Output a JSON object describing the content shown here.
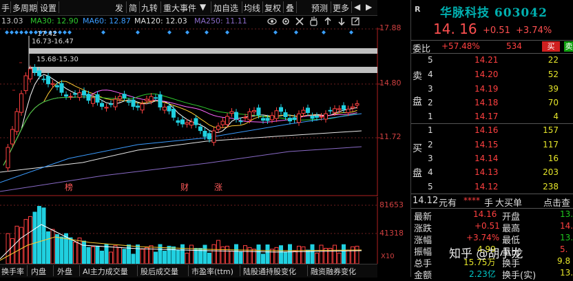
{
  "toolbar": {
    "left_items": [
      "手",
      "多周期",
      "设置"
    ],
    "right_items": [
      "发",
      "简",
      "九转",
      "重大事件",
      "加自选",
      "均线",
      "复权",
      "叠",
      "预测",
      "更多"
    ],
    "dropdown_arrow": "▼",
    "prev_arrow": "◀",
    "next_arrow": "▶"
  },
  "ma_legend": [
    {
      "label": "13.03",
      "color": "#c8c8c8"
    },
    {
      "label": "MA30: 12.90",
      "color": "#2ec82e"
    },
    {
      "label": "MA60: 12.87",
      "color": "#3b9cff"
    },
    {
      "label": "MA120: 12.03",
      "color": "#e0e0e0"
    },
    {
      "label": "MA250: 11.11",
      "color": "#8a6bc8"
    }
  ],
  "ma_icons": [
    "eye-icon",
    "settings-icon",
    "close-icon",
    "hand-icon",
    "arrow-up-icon",
    "arrow-down-icon",
    "share-icon"
  ],
  "price_axis": [
    "17.88",
    "14.80",
    "11.72"
  ],
  "annotations": {
    "top_pointer": "17.42",
    "band1": "16.73-16.47",
    "band2": "15.68-15.30",
    "events": [
      "榜",
      "财",
      "涨"
    ]
  },
  "volume_axis": [
    "81653",
    "41318",
    "X10"
  ],
  "bottom_tabs": [
    "换手率",
    "内盘",
    "外盘",
    "AI主力成交量",
    "股后成交量",
    "市盈率(ttm)",
    "陆股通持股变化",
    "融资融券变化"
  ],
  "stock": {
    "letter": "R",
    "name": "华脉科技",
    "code": "603042",
    "price": "14. 16",
    "change": "+0.51",
    "change_pct": "+3.74%"
  },
  "weibi": {
    "label": "委比",
    "value": "+57.48%",
    "diff": "534",
    "buy_btn": "买",
    "sell_btn": "卖"
  },
  "sell_levels": [
    {
      "level": "5",
      "price": "14.21",
      "vol": "22"
    },
    {
      "level": "4",
      "price": "14.20",
      "vol": "52"
    },
    {
      "level": "3",
      "price": "14.19",
      "vol": "39"
    },
    {
      "level": "2",
      "price": "14.18",
      "vol": "70"
    },
    {
      "level": "1",
      "price": "14.17",
      "vol": "4"
    }
  ],
  "sell_vlabel": [
    "卖",
    "盘"
  ],
  "buy_levels": [
    {
      "level": "1",
      "price": "14.16",
      "vol": "157"
    },
    {
      "level": "2",
      "price": "14.15",
      "vol": "117"
    },
    {
      "level": "3",
      "price": "14.14",
      "vol": "16"
    },
    {
      "level": "4",
      "price": "14.13",
      "vol": "203"
    },
    {
      "level": "5",
      "price": "14.12",
      "vol": "238"
    }
  ],
  "buy_vlabel": [
    "买",
    "盘"
  ],
  "big_order": {
    "price": "14.12",
    "unit": "元有",
    "stars": "****",
    "hand": "手",
    "type": "大买单",
    "action": "点击查"
  },
  "stats": [
    {
      "k1": "最新",
      "v1": "14.16",
      "k2": "开盘",
      "v2": "13."
    },
    {
      "k1": "涨跌",
      "v1": "+0.51",
      "k2": "最高",
      "v2": "14."
    },
    {
      "k1": "涨幅",
      "v1": "+3.74%",
      "k2": "最低",
      "v2": "13."
    },
    {
      "k1": "振幅",
      "v1": "4.99",
      "k2": "量比",
      "v2": "5."
    },
    {
      "k1": "总手",
      "v1": "15.75万",
      "k2": "换手",
      "v2": "9.8"
    },
    {
      "k1": "金额",
      "v1": "2.23亿",
      "k2": "换手(实)",
      "v2": "13."
    }
  ],
  "watermark": "知乎 @胡小龙"
}
